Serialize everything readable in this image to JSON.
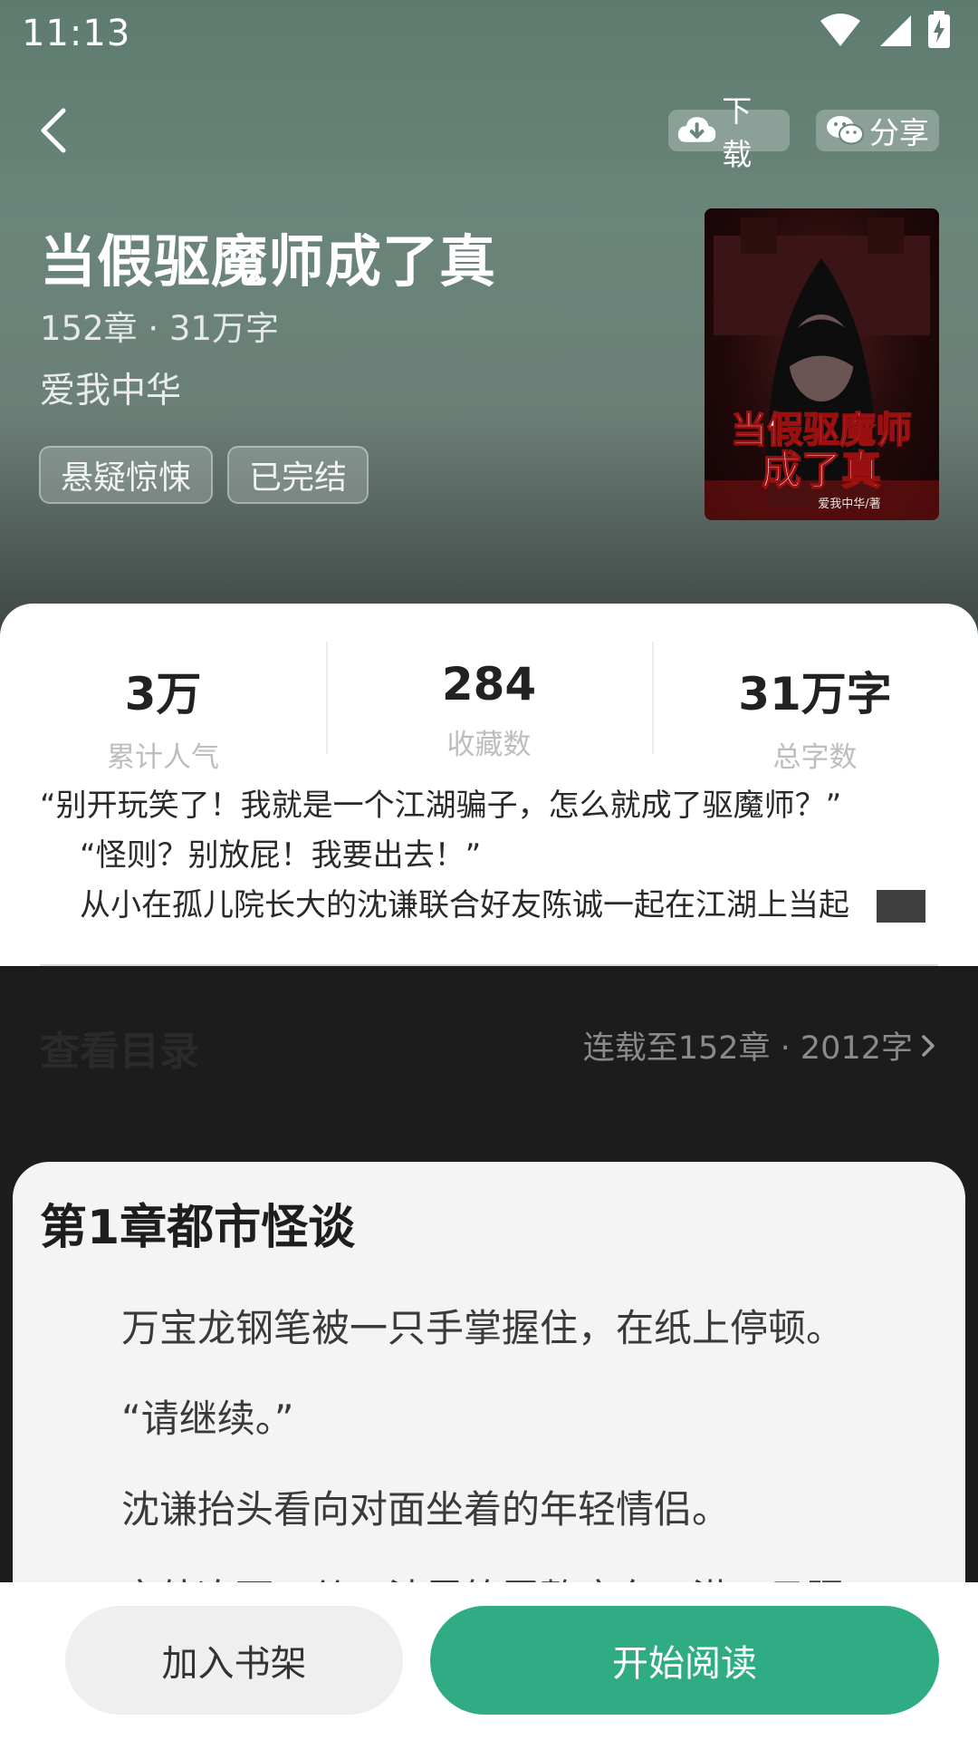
{
  "status_bar": {
    "time": "11:13"
  },
  "toolbar": {
    "download_label": "下载",
    "share_label": "分享"
  },
  "book": {
    "title": "当假驱魔师成了真",
    "meta": "152章 · 31万字",
    "author": "爱我中华",
    "tags": [
      "悬疑惊悚",
      "已完结"
    ],
    "cover": {
      "title_line1": "当假驱魔师",
      "title_line2": "成了真",
      "author_credit": "爱我中华/著"
    }
  },
  "stats": [
    {
      "value": "3万",
      "label": "累计人气"
    },
    {
      "value": "284",
      "label": "收藏数"
    },
    {
      "value": "31万字",
      "label": "总字数"
    }
  ],
  "synopsis": [
    "“别开玩笑了！我就是一个江湖骗子，怎么就成了驱魔师？”",
    "“怪则？别放屁！我要出去！”",
    "从小在孤儿院长大的沈谦联合好友陈诚一起在江湖上当起"
  ],
  "catalog": {
    "title": "查看目录",
    "info": "连载至152章 · 2012字"
  },
  "chapter": {
    "title": "第1章都市怪谈",
    "lines": [
      "万宝龙钢笔被一只手掌握住，在纸上停顿。",
      "“请继续。”",
      "沈谦抬头看向对面坐着的年轻情侣。",
      "窗外冻雨，从一油雷笼罩整座东三港，日照"
    ]
  },
  "bottom": {
    "shelf_label": "加入书架",
    "read_label": "开始阅读"
  },
  "colors": {
    "accent": "#30ac85",
    "header_bg": "#5e7b6f"
  }
}
